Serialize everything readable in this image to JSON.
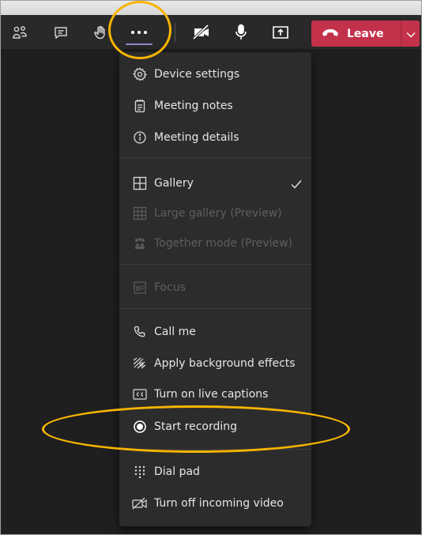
{
  "toolbar": {
    "leave_label": "Leave"
  },
  "menu": {
    "device_settings": "Device settings",
    "meeting_notes": "Meeting notes",
    "meeting_details": "Meeting details",
    "gallery": "Gallery",
    "large_gallery": "Large gallery (Preview)",
    "together_mode": "Together mode (Preview)",
    "focus": "Focus",
    "call_me": "Call me",
    "background_effects": "Apply background effects",
    "live_captions": "Turn on live captions",
    "start_recording": "Start recording",
    "dial_pad": "Dial pad",
    "incoming_video": "Turn off incoming video"
  },
  "icons": {
    "participants": "people-icon",
    "chat": "chat-icon",
    "raise_hand": "raise-hand-icon",
    "more": "more-options-icon",
    "camera_off": "camera-off-icon",
    "microphone": "microphone-icon",
    "share": "share-tray-icon",
    "hang_up": "phone-hangup-icon"
  },
  "colors": {
    "leave_button": "#c4314b",
    "annotation": "#f7b500",
    "accent": "#8b8cc7"
  }
}
